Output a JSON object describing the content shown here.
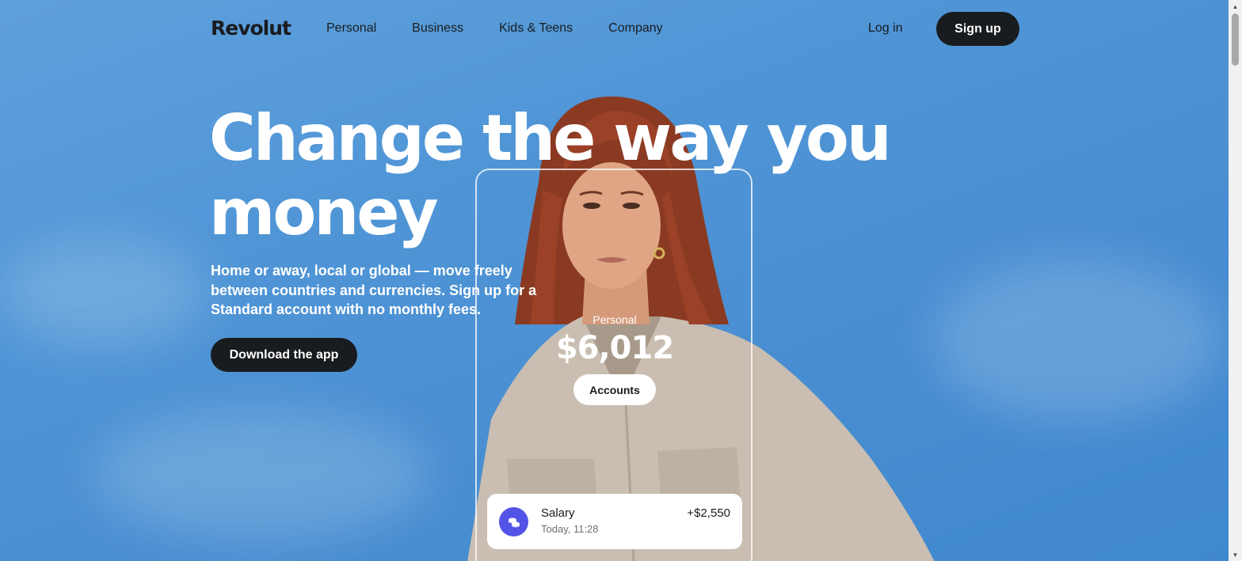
{
  "brand": {
    "name": "Revolut"
  },
  "nav": {
    "items": [
      {
        "label": "Personal"
      },
      {
        "label": "Business"
      },
      {
        "label": "Kids & Teens"
      },
      {
        "label": "Company"
      }
    ],
    "login_label": "Log in",
    "signup_label": "Sign up"
  },
  "hero": {
    "headline": "Change the way you money",
    "subtext": "Home or away, local or global — move freely between countries and currencies. Sign up for a Standard account with no monthly fees.",
    "cta_label": "Download the app"
  },
  "card": {
    "account_label": "Personal",
    "balance": "$6,012",
    "accounts_button": "Accounts",
    "transaction": {
      "title": "Salary",
      "time": "Today, 11:28",
      "amount": "+$2,550",
      "icon": "coins-icon"
    }
  },
  "colors": {
    "dark": "#191c1f",
    "accent": "#5353e6",
    "sky": "#4f95d6"
  }
}
